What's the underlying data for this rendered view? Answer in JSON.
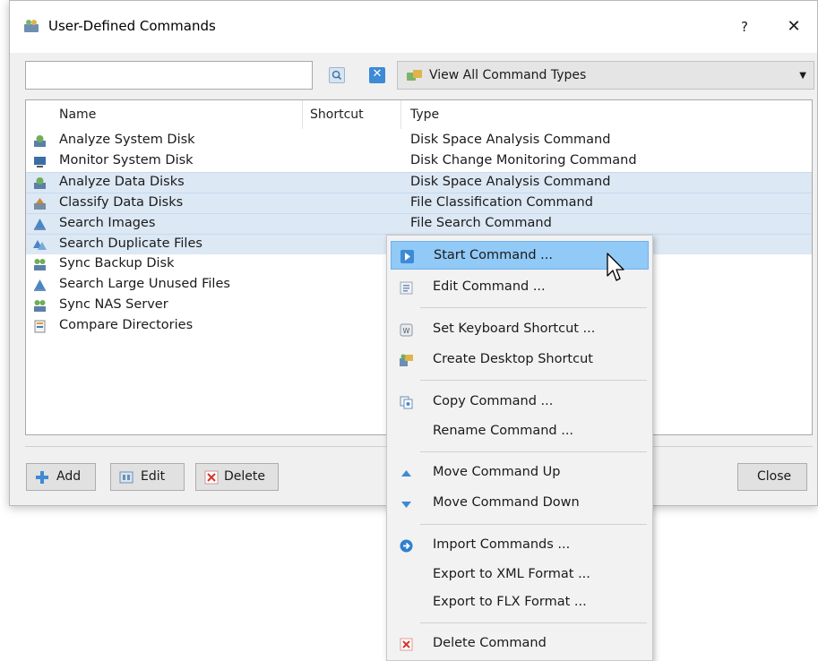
{
  "window": {
    "title": "User-Defined Commands",
    "help_label": "?",
    "close_glyph": "✕"
  },
  "filter": {
    "search_value": "",
    "search_placeholder": "",
    "type_select": "View All Command Types",
    "clear_glyph": "✕"
  },
  "list": {
    "columns": [
      "Name",
      "Shortcut",
      "Type"
    ],
    "rows": [
      {
        "name": "Analyze System Disk",
        "shortcut": "",
        "type": "Disk Space Analysis Command",
        "selected": false,
        "icon": "analysis-icon"
      },
      {
        "name": "Monitor System Disk",
        "shortcut": "",
        "type": "Disk Change Monitoring Command",
        "selected": false,
        "icon": "monitor-icon"
      },
      {
        "name": "Analyze Data Disks",
        "shortcut": "",
        "type": "Disk Space Analysis Command",
        "selected": true,
        "icon": "analysis-icon"
      },
      {
        "name": "Classify Data Disks",
        "shortcut": "",
        "type": "File Classification Command",
        "selected": true,
        "icon": "classify-icon"
      },
      {
        "name": "Search Images",
        "shortcut": "",
        "type": "File Search Command",
        "selected": true,
        "icon": "search-files-icon"
      },
      {
        "name": "Search Duplicate Files",
        "shortcut": "",
        "type": "",
        "selected": true,
        "icon": "duplicate-icon"
      },
      {
        "name": "Sync Backup Disk",
        "shortcut": "",
        "type": "",
        "selected": false,
        "icon": "sync-icon"
      },
      {
        "name": "Search Large Unused Files",
        "shortcut": "",
        "type": "",
        "selected": false,
        "icon": "search-files-icon"
      },
      {
        "name": "Sync NAS Server",
        "shortcut": "",
        "type": "",
        "selected": false,
        "icon": "sync-icon"
      },
      {
        "name": "Compare Directories",
        "shortcut": "",
        "type": "",
        "selected": false,
        "icon": "compare-icon"
      }
    ]
  },
  "buttons": {
    "add": "Add",
    "edit": "Edit",
    "delete": "Delete",
    "close": "Close"
  },
  "context_menu": {
    "items": [
      {
        "label": "Start Command ...",
        "icon": "play-icon",
        "highlighted": true
      },
      {
        "label": "Edit Command ...",
        "icon": "edit-icon"
      },
      {
        "label": "Set Keyboard Shortcut ...",
        "icon": "keyboard-icon"
      },
      {
        "label": "Create Desktop Shortcut",
        "icon": "desktop-shortcut-icon"
      },
      {
        "label": "Copy Command ...",
        "icon": "copy-icon"
      },
      {
        "label": "Rename Command ...",
        "icon": ""
      },
      {
        "label": "Move Command Up",
        "icon": "arrow-up-icon"
      },
      {
        "label": "Move Command Down",
        "icon": "arrow-down-icon"
      },
      {
        "label": "Import Commands ...",
        "icon": "import-icon"
      },
      {
        "label": "Export to XML Format ...",
        "icon": ""
      },
      {
        "label": "Export to FLX Format ...",
        "icon": ""
      },
      {
        "label": "Delete Command",
        "icon": "delete-icon"
      }
    ]
  },
  "colors": {
    "accent": "#3d8ad6",
    "selection": "#dce8f4",
    "menu_highlight": "#91c9f7"
  }
}
